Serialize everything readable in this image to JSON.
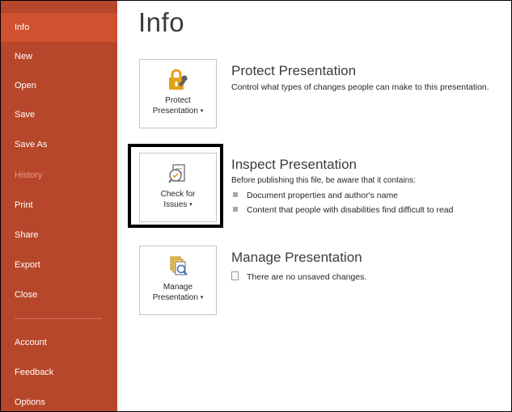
{
  "sidebar": {
    "items": [
      {
        "label": "Info"
      },
      {
        "label": "New"
      },
      {
        "label": "Open"
      },
      {
        "label": "Save"
      },
      {
        "label": "Save As"
      },
      {
        "label": "History"
      },
      {
        "label": "Print"
      },
      {
        "label": "Share"
      },
      {
        "label": "Export"
      },
      {
        "label": "Close"
      },
      {
        "label": "Account"
      },
      {
        "label": "Feedback"
      },
      {
        "label": "Options"
      }
    ]
  },
  "main": {
    "title": "Info",
    "protect": {
      "tile_line1": "Protect",
      "tile_line2": "Presentation",
      "title": "Protect Presentation",
      "description": "Control what types of changes people can make to this presentation."
    },
    "inspect": {
      "tile_line1": "Check for",
      "tile_line2": "Issues",
      "title": "Inspect Presentation",
      "description": "Before publishing this file, be aware that it contains:",
      "bullets": [
        "Document properties and author's name",
        "Content that people with disabilities find difficult to read"
      ]
    },
    "manage": {
      "tile_line1": "Manage",
      "tile_line2": "Presentation",
      "title": "Manage Presentation",
      "status": "There are no unsaved changes."
    }
  },
  "colors": {
    "sidebar_bg": "#b7472a",
    "sidebar_selected": "#d0512f",
    "icon_gold": "#e3a21a"
  }
}
